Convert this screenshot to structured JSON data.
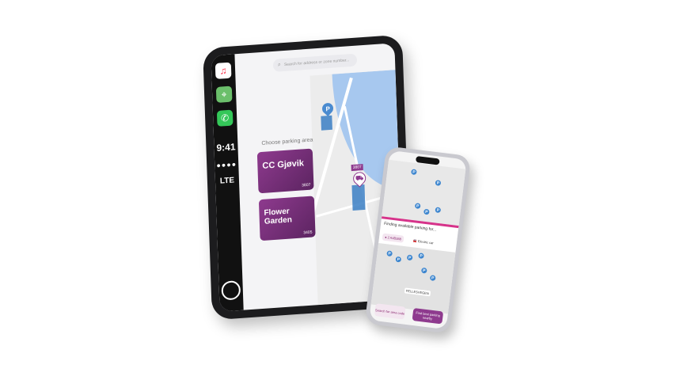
{
  "tablet": {
    "search_placeholder": "Search for address or zone number...",
    "choose_label": "Choose parking area",
    "areas": [
      {
        "name": "CC Gjøvik",
        "code": "3807"
      },
      {
        "name": "Flower Garden",
        "code": "3405"
      }
    ],
    "map_zone_label": "3807",
    "rail": {
      "time": "9:41",
      "signal": "●●●●",
      "network": "LTE"
    },
    "icons": [
      "music-icon",
      "maps-icon",
      "phone-icon"
    ]
  },
  "phone": {
    "banner_title": "Finding available parking for...",
    "chip_left": "● 2 A4B388",
    "chip_right": "🚘 Electric car",
    "tag": "FELLESVEGEN",
    "buttons": {
      "search": "Search for area code",
      "find": "Find best parking nearby"
    }
  },
  "colors": {
    "accent": "#8e3a8e",
    "pin": "#3d86cf",
    "banner_border": "#d6338a"
  }
}
